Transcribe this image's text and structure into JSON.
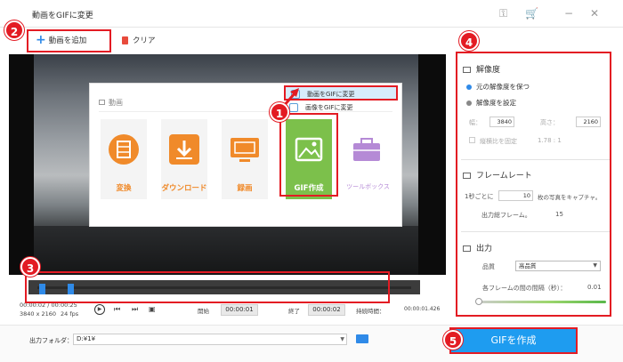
{
  "window": {
    "title": "動画をGIFに変更",
    "controls": [
      "key-icon",
      "cart-icon",
      "minimize-icon",
      "close-icon"
    ]
  },
  "toolbar": {
    "add_video_label": "動画を追加",
    "clear_label": "クリア"
  },
  "launcher": {
    "section_label": "動画",
    "menu": [
      "動画をGIFに変更",
      "画像をGIFに変更"
    ],
    "tiles": [
      {
        "label": "変換",
        "icon": "film-icon"
      },
      {
        "label": "ダウンロード",
        "icon": "download-icon"
      },
      {
        "label": "録画",
        "icon": "screen-record-icon"
      },
      {
        "label": "GIF作成",
        "icon": "image-icon"
      },
      {
        "label": "ツールボックス",
        "icon": "toolbox-icon"
      }
    ]
  },
  "timeline": {
    "position": "00:00:02 / 00:00:25",
    "resolution": "3840 x 2160",
    "fps": "24 fps",
    "start_label": "開始",
    "start_value": "00:00:01",
    "end_label": "終了",
    "end_value": "00:00:02",
    "duration_label": "持続時間：",
    "duration_value": "00:00:01.426"
  },
  "output": {
    "folder_label": "出力フォルダ：",
    "folder_path": "D:¥1¥"
  },
  "settings": {
    "resolution": {
      "title": "解像度",
      "keep_original": "元の解像度を保つ",
      "set_resolution": "解像度を設定",
      "width_label": "幅：",
      "width_value": "3840",
      "height_label": "高さ：",
      "height_value": "2160",
      "aspect_label": "縦横比を固定",
      "aspect_value": "1.78 : 1"
    },
    "framerate": {
      "title": "フレームレート",
      "per_second_label": "1秒ごとに",
      "per_second_value": "10",
      "per_second_suffix": "枚の写真をキャプチャ。",
      "total_label": "出力総フレーム。",
      "total_value": "15"
    },
    "output": {
      "title": "出力",
      "quality_label": "品質",
      "quality_value": "高品質",
      "interval_label": "各フレームの間の間隔（秒）：",
      "interval_value": "0.01"
    }
  },
  "action": {
    "create_gif_label": "GIFを作成"
  },
  "annotations": [
    "1",
    "2",
    "3",
    "4",
    "5"
  ],
  "colors": {
    "accent": "#1e9cf0",
    "tile_orange": "#f08a2a",
    "gif_green": "#7cc04b",
    "toolbox_purple": "#b58ad6",
    "highlight_red": "#e31b23"
  }
}
